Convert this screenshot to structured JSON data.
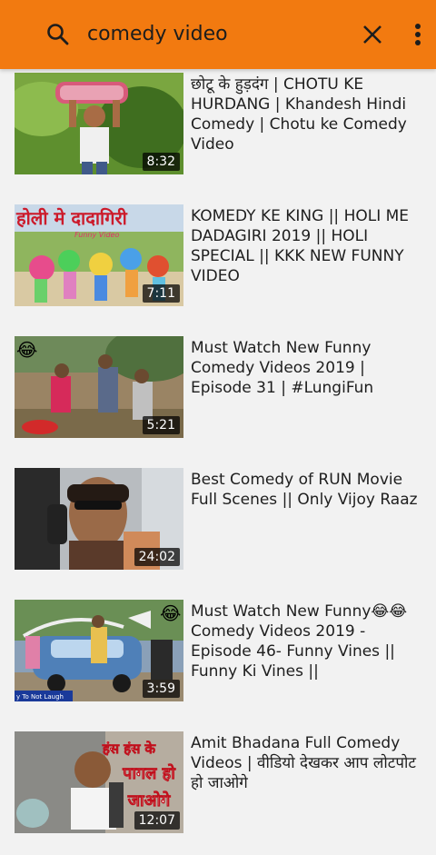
{
  "search": {
    "query": "comedy video",
    "icons": {
      "search": "search-icon",
      "clear": "close-icon",
      "more": "more-vert-icon"
    }
  },
  "colors": {
    "toolbar": "#f27a10",
    "background": "#f2f2f2"
  },
  "results": [
    {
      "title": "छोटू के हुड़दंग | CHOTU KE HURDANG | Khandesh Hindi Comedy | Chotu ke Comedy Video",
      "duration": "8:32"
    },
    {
      "title": "KOMEDY KE KING || HOLI ME DADAGIRI 2019 || HOLI SPECIAL || KKK NEW FUNNY VIDEO",
      "duration": "7:11",
      "thumb_text": {
        "main": "होली मे दादागिरी",
        "sub": "Funny Video"
      }
    },
    {
      "title": "Must Watch New Funny Comedy Videos 2019 | Episode 31 | #LungiFun",
      "duration": "5:21",
      "thumb_emoji": "😂"
    },
    {
      "title": "Best Comedy of RUN Movie Full Scenes || Only Vijoy Raaz",
      "duration": "24:02"
    },
    {
      "title": "Must Watch New Funny😂😂Comedy Videos 2019 - Episode 46- Funny Vines || Funny Ki Vines ||",
      "duration": "3:59",
      "thumb_text": {
        "corner": "y To Not Laugh"
      },
      "thumb_emoji": "😂"
    },
    {
      "title": "Amit Bhadana Full Comedy Videos | वीडियो देखकर आप लोटपोट हो जाओगे",
      "duration": "12:07",
      "thumb_text": {
        "line1": "हंस हंस के",
        "line2": "पागल हो",
        "line3": "जाओगे"
      }
    }
  ]
}
